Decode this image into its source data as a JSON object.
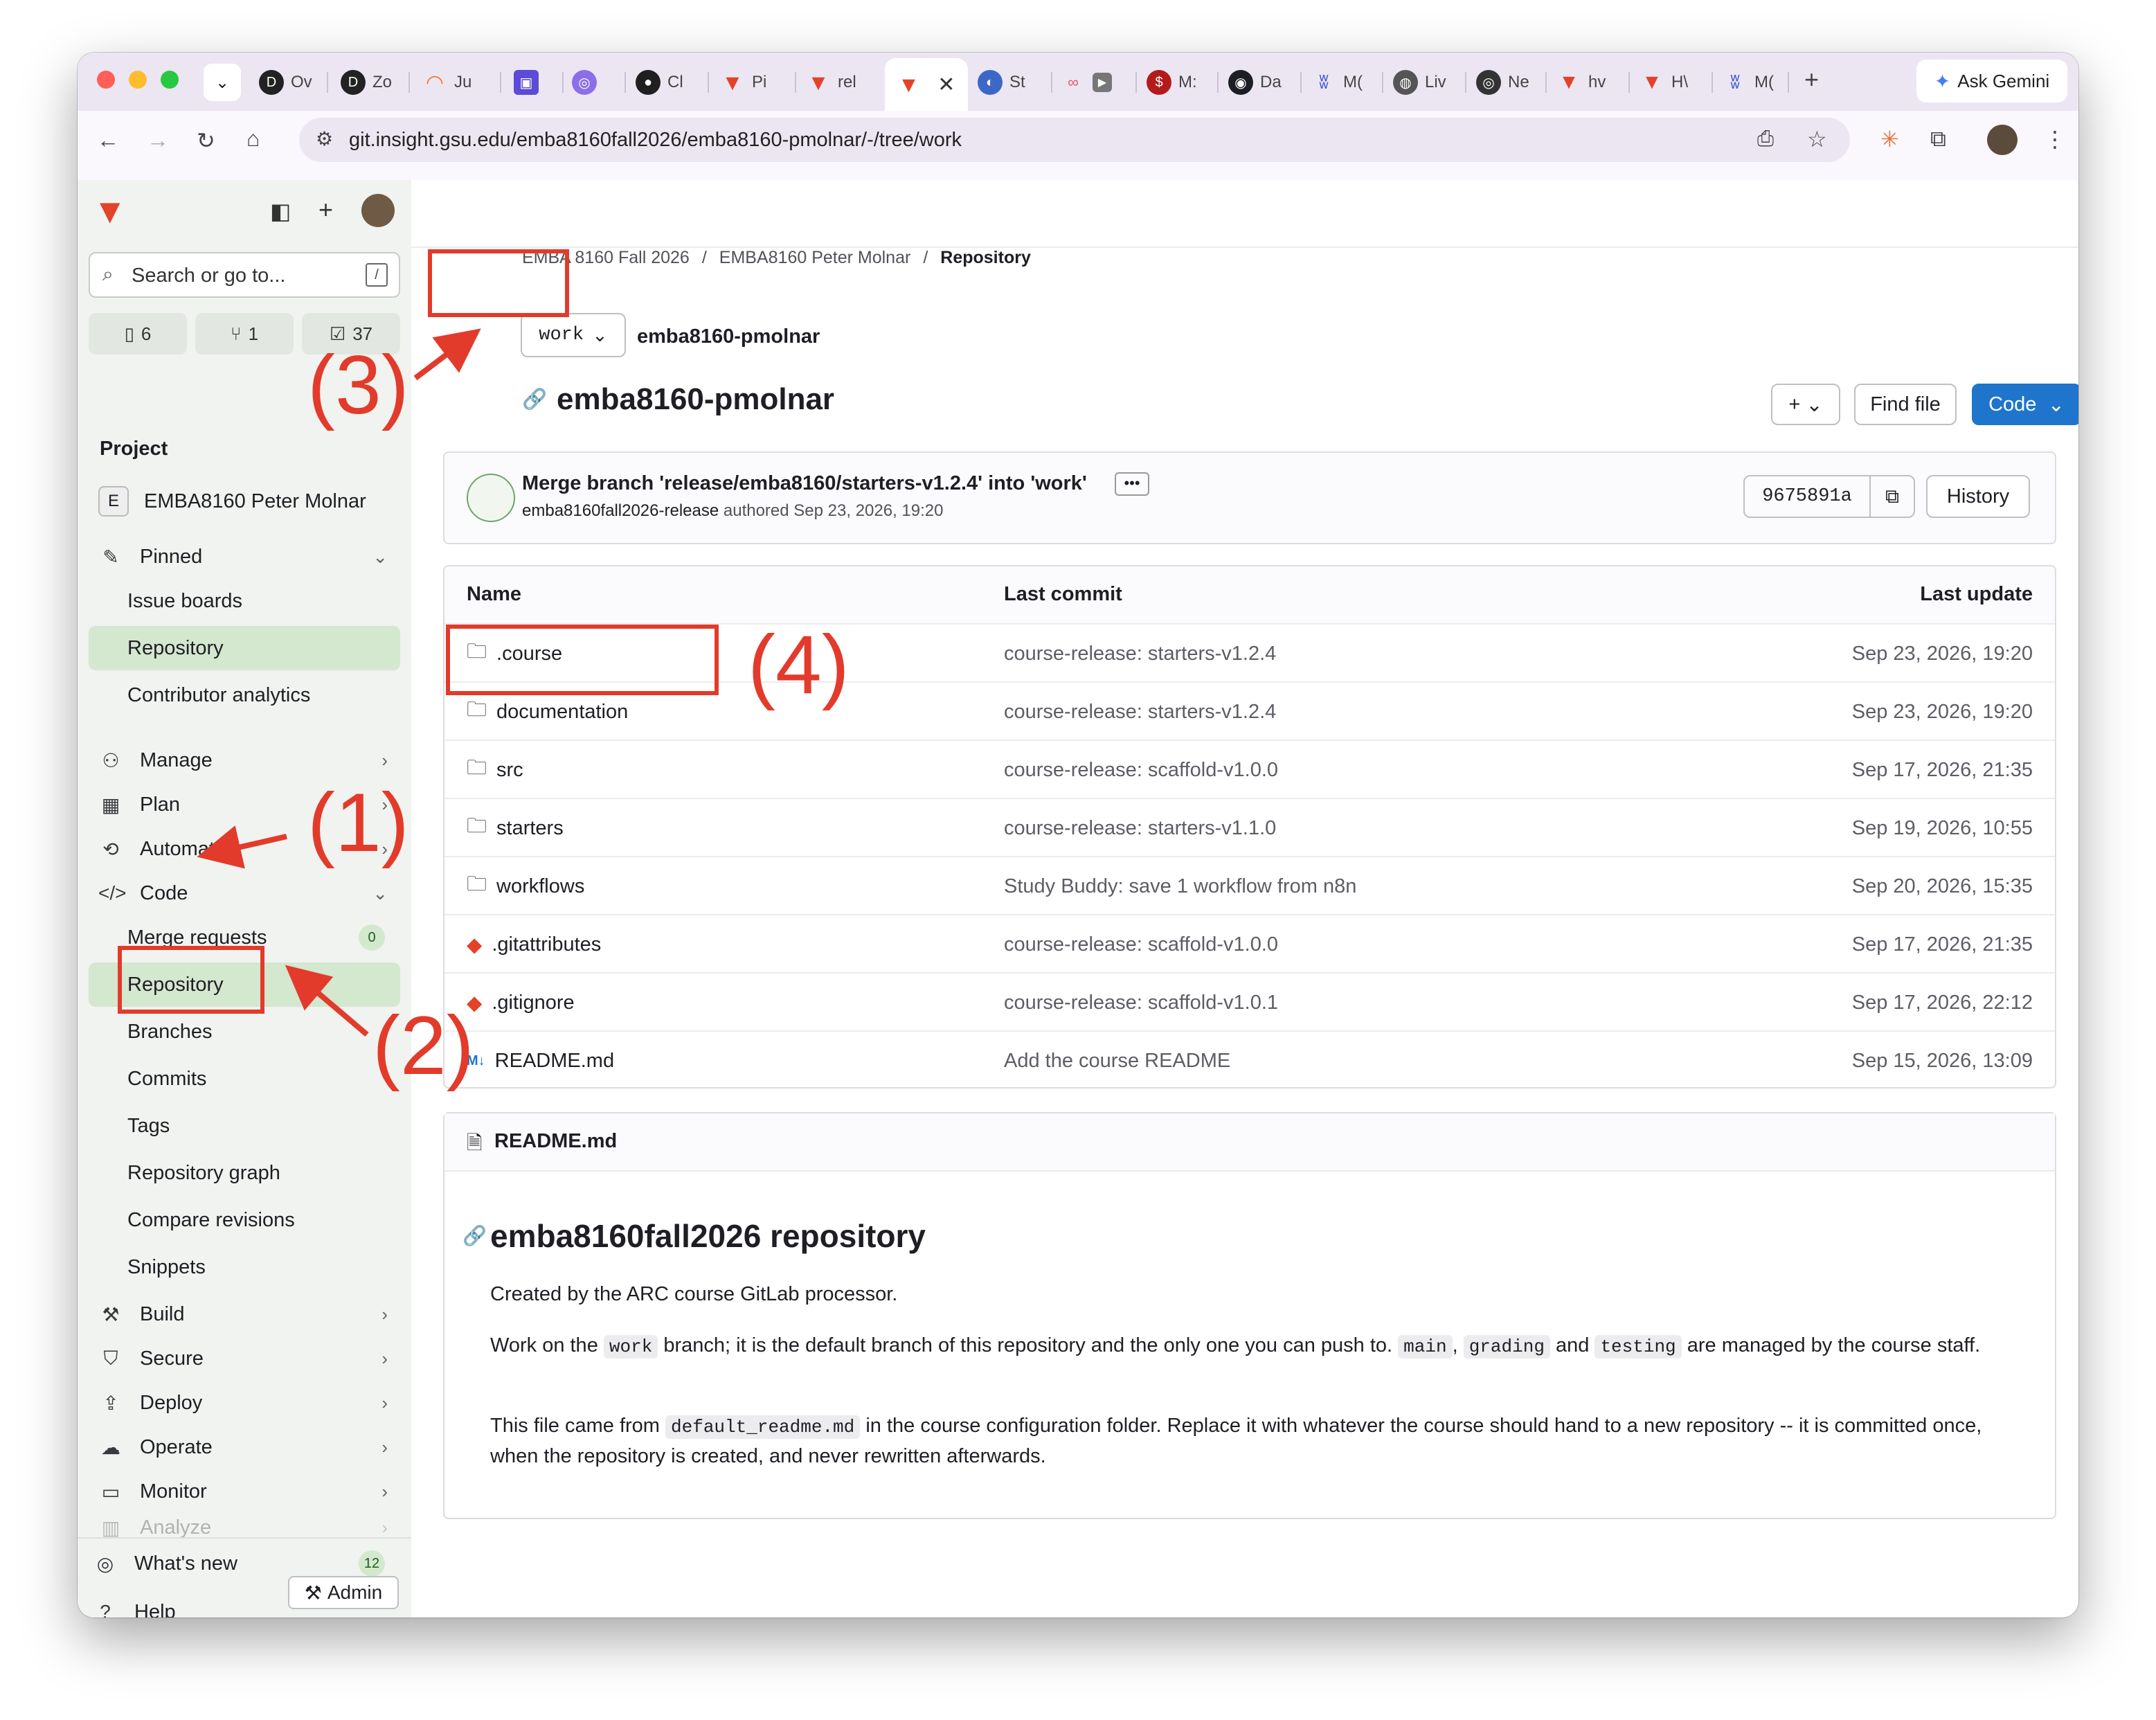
{
  "browser": {
    "tabs": [
      "Ov",
      "Zo",
      "Ju",
      "",
      "",
      "Cl",
      "Pi",
      "rel",
      "",
      "St",
      "",
      "M:",
      "Da",
      "M(",
      "Liv",
      "Ne",
      "hv",
      "H\\",
      "M("
    ],
    "new_tab": "+",
    "ask_gemini": "Ask Gemini",
    "url": "git.insight.gsu.edu/emba8160fall2026/emba8160-pmolnar/-/tree/work"
  },
  "sidebar": {
    "search_placeholder": "Search or go to...",
    "search_shortcut": "/",
    "counters": [
      {
        "icon": "issues-icon",
        "value": "6"
      },
      {
        "icon": "merge-request-icon",
        "value": "1"
      },
      {
        "icon": "todo-icon",
        "value": "37"
      }
    ],
    "project_heading": "Project",
    "project_avatar": "E",
    "project_name": "EMBA8160 Peter Molnar",
    "pinned_label": "Pinned",
    "pinned_items": [
      "Issue boards",
      "Repository",
      "Contributor analytics"
    ],
    "manage": "Manage",
    "plan": "Plan",
    "automate": "Automate",
    "code": "Code",
    "code_items": [
      "Merge requests",
      "Repository",
      "Branches",
      "Commits",
      "Tags",
      "Repository graph",
      "Compare revisions",
      "Snippets"
    ],
    "merge_requests_count": "0",
    "build": "Build",
    "secure": "Secure",
    "deploy": "Deploy",
    "operate": "Operate",
    "monitor": "Monitor",
    "analyze": "Analyze",
    "whats_new": "What's new",
    "whats_new_count": "12",
    "help": "Help",
    "admin": "Admin"
  },
  "breadcrumb": [
    "EMBA 8160 Fall 2026",
    "EMBA8160 Peter Molnar",
    "Repository"
  ],
  "repo": {
    "branch": "work",
    "path": "emba8160-pmolnar",
    "title": "emba8160-pmolnar",
    "find_file": "Find file",
    "code_button": "Code",
    "commit_title": "Merge branch 'release/emba8160/starters-v1.2.4' into 'work'",
    "commit_author": "emba8160fall2026-release",
    "commit_meta": "authored Sep 23, 2026, 19:20",
    "commit_sha": "9675891a",
    "history": "History"
  },
  "table": {
    "headers": [
      "Name",
      "Last commit",
      "Last update"
    ],
    "rows": [
      {
        "name": ".course",
        "type": "folder",
        "commit": "course-release: starters-v1.2.4",
        "date": "Sep 23, 2026, 19:20"
      },
      {
        "name": "documentation",
        "type": "folder",
        "commit": "course-release: starters-v1.2.4",
        "date": "Sep 23, 2026, 19:20"
      },
      {
        "name": "src",
        "type": "folder",
        "commit": "course-release: scaffold-v1.0.0",
        "date": "Sep 17, 2026, 21:35"
      },
      {
        "name": "starters",
        "type": "folder",
        "commit": "course-release: starters-v1.1.0",
        "date": "Sep 19, 2026, 10:55"
      },
      {
        "name": "workflows",
        "type": "folder",
        "commit": "Study Buddy: save 1 workflow from n8n",
        "date": "Sep 20, 2026, 15:35"
      },
      {
        "name": ".gitattributes",
        "type": "git",
        "commit": "course-release: scaffold-v1.0.0",
        "date": "Sep 17, 2026, 21:35"
      },
      {
        "name": ".gitignore",
        "type": "git",
        "commit": "course-release: scaffold-v1.0.1",
        "date": "Sep 17, 2026, 22:12"
      },
      {
        "name": "README.md",
        "type": "markdown",
        "commit": "Add the course README",
        "date": "Sep 15, 2026, 13:09"
      }
    ]
  },
  "readme": {
    "file_label": "README.md",
    "heading": "emba8160fall2026 repository",
    "p1": "Created by the ARC course GitLab processor.",
    "p2_a": "Work on the",
    "p2_code1": "work",
    "p2_b": "branch; it is the default branch of this repository and the only one you can push to.",
    "p2_code2": "main",
    "p2_c": ",",
    "p2_code3": "grading",
    "p2_d": "and",
    "p2_code4": "testing",
    "p2_e": "are managed by the course staff.",
    "p3_a": "This file came from",
    "p3_code": "default_readme.md",
    "p3_b": "in the course configuration folder. Replace it with whatever the course should hand to a new repository -- it is committed once, when the repository is created, and never rewritten afterwards."
  },
  "annotations": [
    "(1)",
    "(2)",
    "(3)",
    "(4)"
  ],
  "colors": {
    "annotation": "#e23b2b",
    "primary": "#1f75cb",
    "sidebar_active": "#d4e7cf"
  }
}
